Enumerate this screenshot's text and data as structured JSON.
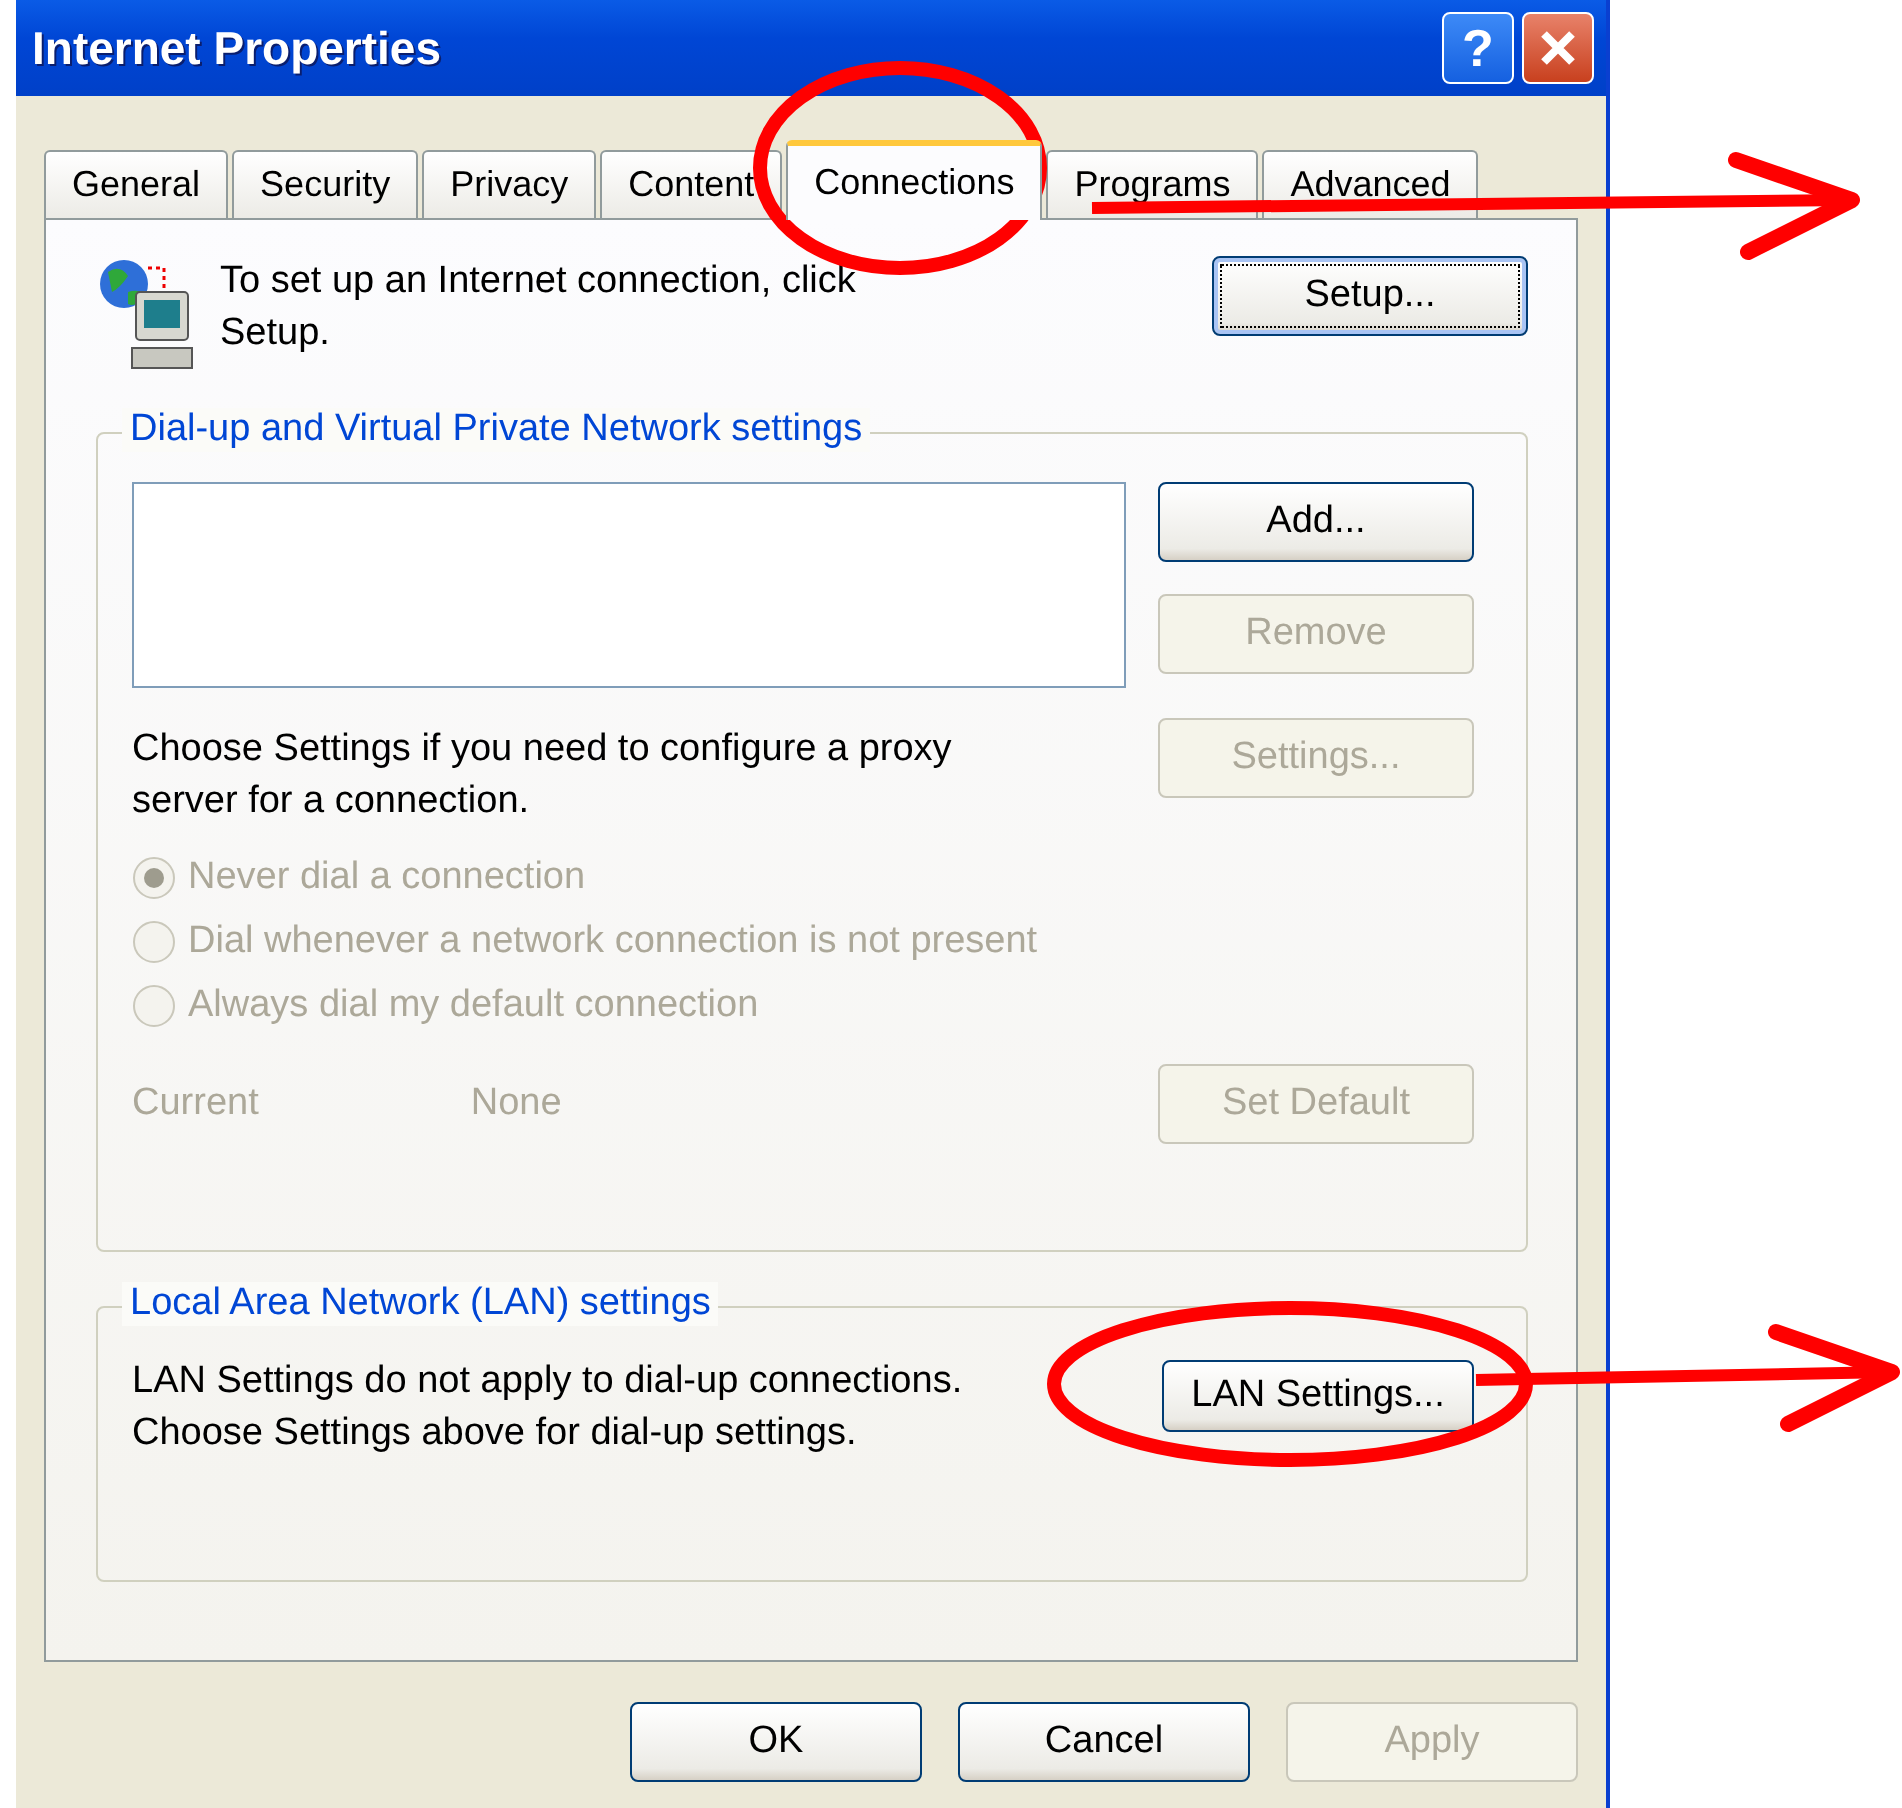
{
  "window": {
    "title": "Internet Properties",
    "help_label": "?"
  },
  "tabs": [
    {
      "label": "General",
      "selected": false
    },
    {
      "label": "Security",
      "selected": false
    },
    {
      "label": "Privacy",
      "selected": false
    },
    {
      "label": "Content",
      "selected": false
    },
    {
      "label": "Connections",
      "selected": true
    },
    {
      "label": "Programs",
      "selected": false
    },
    {
      "label": "Advanced",
      "selected": false
    }
  ],
  "setup": {
    "text_lines": [
      "To set up an Internet connection, click",
      "Setup."
    ],
    "button": {
      "label": "Setup...",
      "disabled": false,
      "focused": true
    }
  },
  "dialup_group": {
    "title": "Dial-up and Virtual Private Network settings",
    "buttons": [
      {
        "label": "Add...",
        "disabled": false,
        "focused": false
      },
      {
        "label": "Remove",
        "disabled": true,
        "focused": false
      },
      {
        "label": "Settings...",
        "disabled": true,
        "focused": false
      }
    ],
    "proxy_text_lines": [
      "Choose Settings if you need to configure a proxy",
      "server for a connection."
    ],
    "radios": [
      {
        "label": "Never dial a connection",
        "selected": true,
        "disabled": true
      },
      {
        "label": "Dial whenever a network connection is not present",
        "selected": false,
        "disabled": true
      },
      {
        "label": "Always dial my default connection",
        "selected": false,
        "disabled": true
      }
    ],
    "current_label": "Current",
    "current_value": "None",
    "set_default": {
      "label": "Set Default",
      "disabled": true,
      "focused": false
    }
  },
  "lan_group": {
    "title": "Local Area Network (LAN) settings",
    "text_lines": [
      "LAN Settings do not apply to dial-up connections.",
      "Choose Settings above for dial-up settings."
    ],
    "button": {
      "label": "LAN Settings...",
      "disabled": false,
      "focused": false
    }
  },
  "footer_buttons": [
    {
      "label": "OK",
      "disabled": false,
      "focused": false
    },
    {
      "label": "Cancel",
      "disabled": false,
      "focused": false
    },
    {
      "label": "Apply",
      "disabled": true,
      "focused": false
    }
  ],
  "annotations": [
    {
      "kind": "circle_arrow"
    },
    {
      "kind": "circle_arrow"
    }
  ]
}
